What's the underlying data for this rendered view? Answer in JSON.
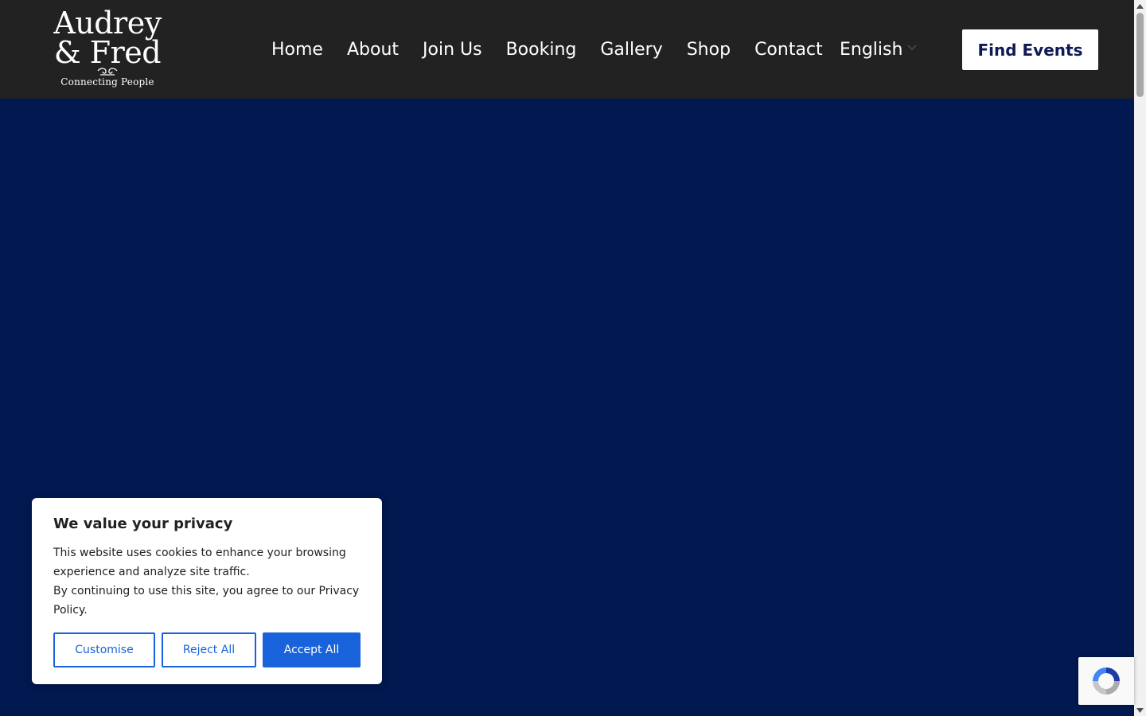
{
  "logo": {
    "line1": "Audrey",
    "line2": "& Fred",
    "tagline": "Connecting People"
  },
  "nav": {
    "items": [
      {
        "label": "Home"
      },
      {
        "label": "About"
      },
      {
        "label": "Join Us"
      },
      {
        "label": "Booking"
      },
      {
        "label": "Gallery"
      },
      {
        "label": "Shop"
      },
      {
        "label": "Contact"
      }
    ],
    "language": "English",
    "cta_label": "Find Events"
  },
  "cookie_banner": {
    "title": "We value your privacy",
    "text_line1": "This website uses cookies to enhance your browsing experience and analyze site traffic.",
    "text_line2": "By continuing to use this site, you agree to our Privacy Policy.",
    "customise_label": "Customise",
    "reject_label": "Reject All",
    "accept_label": "Accept All"
  },
  "colors": {
    "header_bg": "#222222",
    "hero_bg": "#021851",
    "accent": "#1863dc",
    "cta_text": "#0e1a55"
  },
  "icons": {
    "language_dropdown": "chevron-down-icon",
    "recaptcha": "recaptcha-icon",
    "logo_ornament": "ornament-icon"
  }
}
